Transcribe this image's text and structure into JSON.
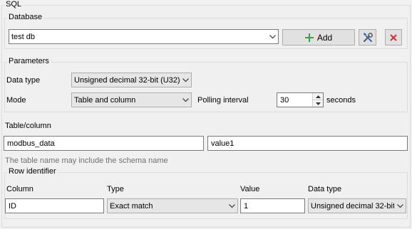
{
  "sql_group": {
    "title": "SQL"
  },
  "database": {
    "title": "Database",
    "selected": "test db",
    "add_label": "Add",
    "add_icon": "plus-icon",
    "settings_icon": "tools-icon",
    "delete_icon": "close-icon"
  },
  "parameters": {
    "title": "Parameters",
    "data_type_label": "Data type",
    "data_type_value": "Unsigned decimal 32-bit (U32)",
    "mode_label": "Mode",
    "mode_value": "Table and column",
    "polling_label": "Polling interval",
    "polling_value": "30",
    "polling_unit": "seconds"
  },
  "table_column": {
    "title": "Table/column",
    "table_value": "modbus_data",
    "column_value": "value1",
    "hint": "The table name may include the schema name"
  },
  "row_identifier": {
    "title": "Row identifier",
    "headers": {
      "column": "Column",
      "type": "Type",
      "value": "Value",
      "data_type": "Data type"
    },
    "column_value": "ID",
    "type_value": "Exact match",
    "value_value": "1",
    "data_type_value": "Unsigned decimal 32-bit"
  },
  "colors": {
    "add_icon": "#2aa84a",
    "delete_icon": "#d0312d"
  }
}
